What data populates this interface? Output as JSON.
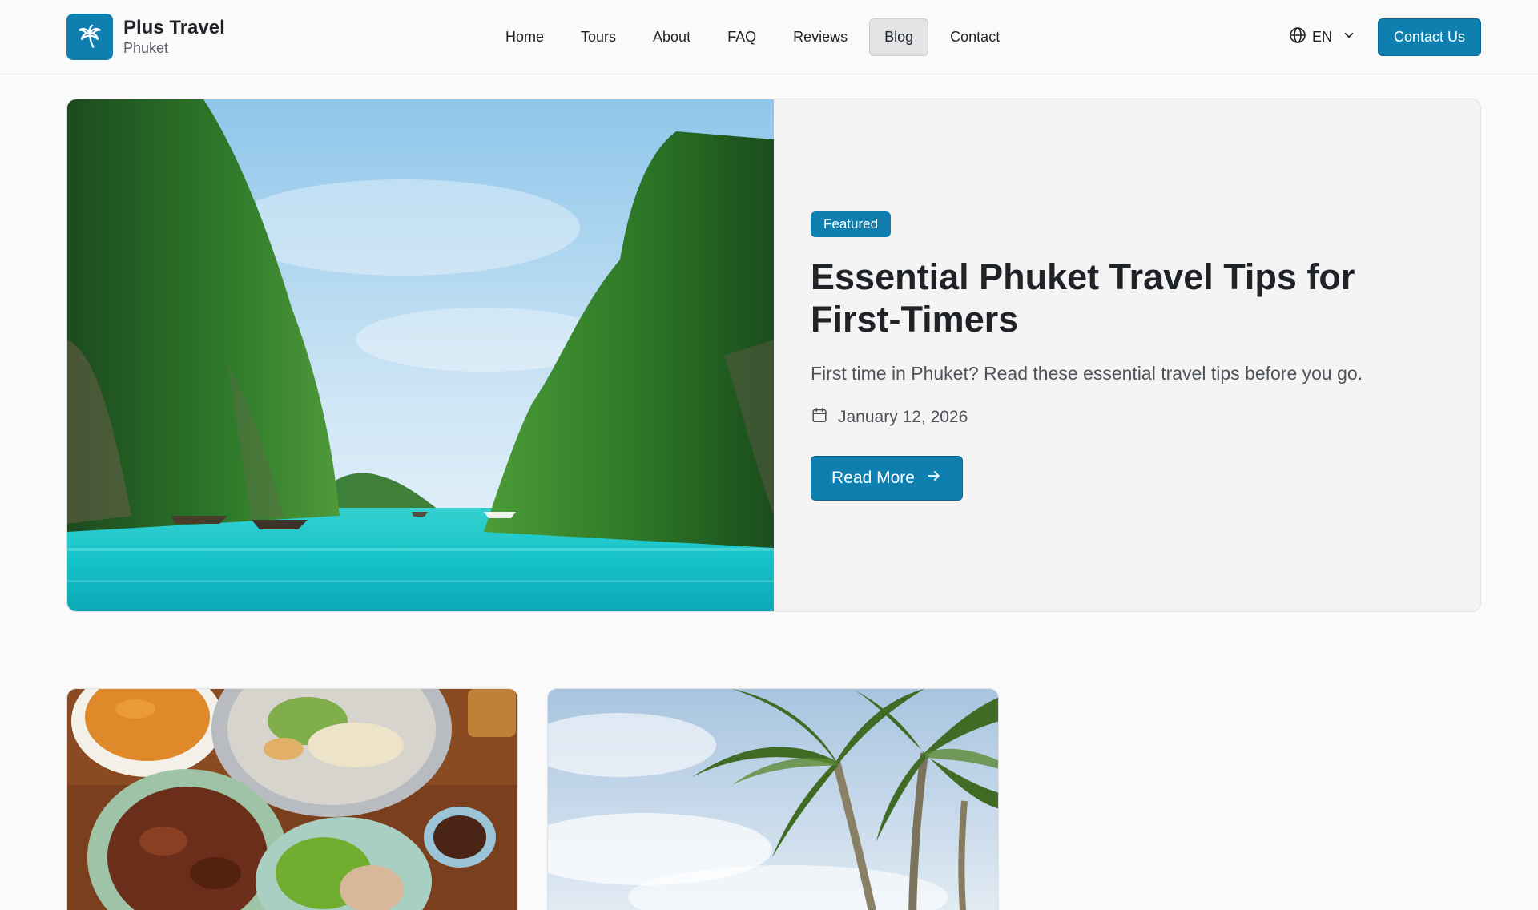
{
  "header": {
    "brand_name": "Plus Travel",
    "brand_location": "Phuket",
    "nav": [
      {
        "label": "Home",
        "active": false
      },
      {
        "label": "Tours",
        "active": false
      },
      {
        "label": "About",
        "active": false
      },
      {
        "label": "FAQ",
        "active": false
      },
      {
        "label": "Reviews",
        "active": false
      },
      {
        "label": "Blog",
        "active": true
      },
      {
        "label": "Contact",
        "active": false
      }
    ],
    "language": "EN",
    "contact_label": "Contact Us"
  },
  "featured": {
    "badge": "Featured",
    "title": "Essential Phuket Travel Tips for First-Timers",
    "excerpt": "First time in Phuket? Read these essential travel tips before you go.",
    "date": "January 12, 2026",
    "read_more_label": "Read More",
    "image": "lagoon-limestone-cliffs-boats-photo"
  },
  "posts": [
    {
      "image": "thai-food-dishes-photo"
    },
    {
      "image": "palm-trees-sky-photo"
    }
  ],
  "colors": {
    "accent": "#0f7fb0",
    "background": "#fafafa",
    "card_background": "#f4f4f4",
    "text": "#1f2328",
    "muted_text": "#4e535a"
  },
  "icons": {
    "logo": "palm-tree-icon",
    "language": "globe-icon",
    "language_toggle": "chevron-down-icon",
    "date": "calendar-icon",
    "read_more": "arrow-right-icon"
  }
}
